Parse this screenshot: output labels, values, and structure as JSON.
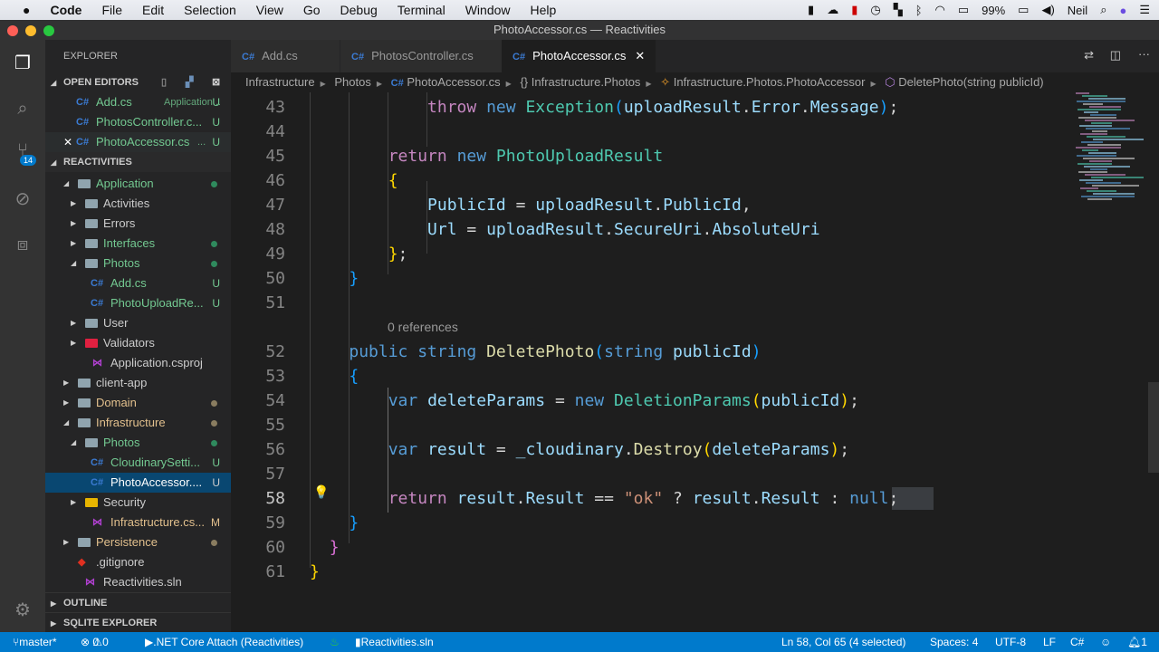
{
  "menubar": {
    "apple": "",
    "app": "Code",
    "items": [
      "File",
      "Edit",
      "Selection",
      "View",
      "Go",
      "Debug",
      "Terminal",
      "Window",
      "Help"
    ],
    "battery": "99%",
    "user": "Neil"
  },
  "window": {
    "title": "PhotoAccessor.cs — Reactivities"
  },
  "sidebar": {
    "title": "EXPLORER",
    "open_editors_label": "OPEN EDITORS",
    "open_editors": [
      {
        "name": "Add.cs",
        "desc": "Application...",
        "status": "U"
      },
      {
        "name": "PhotosController.c...",
        "status": "U"
      },
      {
        "name": "PhotoAccessor.cs",
        "desc": "...",
        "status": "U"
      }
    ],
    "project_label": "REACTIVITIES",
    "tree": [
      {
        "name": "Application",
        "depth": 0,
        "type": "folder",
        "open": true,
        "color": "g",
        "dot": "#2f8a5d"
      },
      {
        "name": "Activities",
        "depth": 1,
        "type": "folder",
        "open": false,
        "color": "w"
      },
      {
        "name": "Errors",
        "depth": 1,
        "type": "folder",
        "open": false,
        "color": "w"
      },
      {
        "name": "Interfaces",
        "depth": 1,
        "type": "folder",
        "open": false,
        "color": "g",
        "dot": "#2f8a5d"
      },
      {
        "name": "Photos",
        "depth": 1,
        "type": "folder",
        "open": true,
        "color": "g",
        "dot": "#2f8a5d"
      },
      {
        "name": "Add.cs",
        "depth": 2,
        "type": "cs",
        "color": "g",
        "status": "U"
      },
      {
        "name": "PhotoUploadRe...",
        "depth": 2,
        "type": "cs",
        "color": "g",
        "status": "U"
      },
      {
        "name": "User",
        "depth": 1,
        "type": "folder",
        "open": false,
        "color": "w"
      },
      {
        "name": "Validators",
        "depth": 1,
        "type": "redfolder",
        "open": false,
        "color": "w"
      },
      {
        "name": "Application.csproj",
        "depth": 1,
        "type": "vs",
        "color": "w"
      },
      {
        "name": "client-app",
        "depth": 0,
        "type": "folder",
        "open": false,
        "color": "w"
      },
      {
        "name": "Domain",
        "depth": 0,
        "type": "folder",
        "open": false,
        "color": "y",
        "dot": "#8a7d60"
      },
      {
        "name": "Infrastructure",
        "depth": 0,
        "type": "folder",
        "open": true,
        "color": "y",
        "dot": "#8a7d60"
      },
      {
        "name": "Photos",
        "depth": 1,
        "type": "folder",
        "open": true,
        "color": "g",
        "dot": "#2f8a5d"
      },
      {
        "name": "CloudinarySetti...",
        "depth": 2,
        "type": "cs",
        "color": "g",
        "status": "U"
      },
      {
        "name": "PhotoAccessor....",
        "depth": 2,
        "type": "cs",
        "color": "w",
        "status": "U",
        "selected": true
      },
      {
        "name": "Security",
        "depth": 1,
        "type": "yfolder",
        "open": false,
        "color": "w"
      },
      {
        "name": "Infrastructure.cs...",
        "depth": 1,
        "type": "vs",
        "color": "y",
        "status": "M"
      },
      {
        "name": "Persistence",
        "depth": 0,
        "type": "folder",
        "open": false,
        "color": "y",
        "dot": "#8a7d60"
      },
      {
        "name": ".gitignore",
        "depth": 0,
        "type": "git",
        "color": "w"
      },
      {
        "name": "Reactivities.sln",
        "depth": 0,
        "type": "vs",
        "color": "w"
      }
    ],
    "outline_label": "OUTLINE",
    "sqlite_label": "SQLITE EXPLORER"
  },
  "activity": {
    "scm_badge": "14"
  },
  "tabs": [
    {
      "label": "Add.cs",
      "icon": "C#"
    },
    {
      "label": "PhotosController.cs",
      "icon": "C#"
    },
    {
      "label": "PhotoAccessor.cs",
      "icon": "C#",
      "active": true
    }
  ],
  "breadcrumb": [
    "Infrastructure",
    "Photos",
    "PhotoAccessor.cs",
    "Infrastructure.Photos",
    "Infrastructure.Photos.PhotoAccessor",
    "DeletePhoto(string publicId)"
  ],
  "editor": {
    "codelens": "0 references",
    "lines": [
      {
        "n": 43,
        "t": [
          [
            "            ",
            "pl"
          ],
          [
            "throw ",
            "kw"
          ],
          [
            "new ",
            "kb"
          ],
          [
            "Exception",
            "ty"
          ],
          [
            "(",
            "br3"
          ],
          [
            "uploadResult",
            "va"
          ],
          [
            ".",
            "pl"
          ],
          [
            "Error",
            "va"
          ],
          [
            ".",
            "pl"
          ],
          [
            "Message",
            "va"
          ],
          [
            ")",
            "br3"
          ],
          [
            ";",
            "pl"
          ]
        ]
      },
      {
        "n": 44,
        "t": []
      },
      {
        "n": 45,
        "t": [
          [
            "        ",
            "pl"
          ],
          [
            "return ",
            "kw"
          ],
          [
            "new ",
            "kb"
          ],
          [
            "PhotoUploadResult",
            "ty"
          ]
        ]
      },
      {
        "n": 46,
        "t": [
          [
            "        ",
            "pl"
          ],
          [
            "{",
            "br1"
          ]
        ]
      },
      {
        "n": 47,
        "t": [
          [
            "            ",
            "pl"
          ],
          [
            "PublicId",
            "va"
          ],
          [
            " = ",
            "pl"
          ],
          [
            "uploadResult",
            "va"
          ],
          [
            ".",
            "pl"
          ],
          [
            "PublicId",
            "va"
          ],
          [
            ",",
            "pl"
          ]
        ]
      },
      {
        "n": 48,
        "t": [
          [
            "            ",
            "pl"
          ],
          [
            "Url",
            "va"
          ],
          [
            " = ",
            "pl"
          ],
          [
            "uploadResult",
            "va"
          ],
          [
            ".",
            "pl"
          ],
          [
            "SecureUri",
            "va"
          ],
          [
            ".",
            "pl"
          ],
          [
            "AbsoluteUri",
            "va"
          ]
        ]
      },
      {
        "n": 49,
        "t": [
          [
            "        ",
            "pl"
          ],
          [
            "}",
            "br1"
          ],
          [
            ";",
            "pl"
          ]
        ]
      },
      {
        "n": 50,
        "t": [
          [
            "    ",
            "pl"
          ],
          [
            "}",
            "br3"
          ]
        ]
      },
      {
        "n": 51,
        "t": []
      },
      {
        "n": 52,
        "t": [
          [
            "    ",
            "pl"
          ],
          [
            "public ",
            "kb"
          ],
          [
            "string ",
            "kb"
          ],
          [
            "DeletePhoto",
            "fn"
          ],
          [
            "(",
            "br3"
          ],
          [
            "string ",
            "kb"
          ],
          [
            "publicId",
            "va"
          ],
          [
            ")",
            "br3"
          ]
        ]
      },
      {
        "n": 53,
        "t": [
          [
            "    ",
            "pl"
          ],
          [
            "{",
            "br3"
          ]
        ]
      },
      {
        "n": 54,
        "t": [
          [
            "        ",
            "pl"
          ],
          [
            "var ",
            "kb"
          ],
          [
            "deleteParams",
            "va"
          ],
          [
            " = ",
            "pl"
          ],
          [
            "new ",
            "kb"
          ],
          [
            "DeletionParams",
            "ty"
          ],
          [
            "(",
            "br1"
          ],
          [
            "publicId",
            "va"
          ],
          [
            ")",
            "br1"
          ],
          [
            ";",
            "pl"
          ]
        ]
      },
      {
        "n": 55,
        "t": []
      },
      {
        "n": 56,
        "t": [
          [
            "        ",
            "pl"
          ],
          [
            "var ",
            "kb"
          ],
          [
            "result",
            "va"
          ],
          [
            " = ",
            "pl"
          ],
          [
            "_cloudinary",
            "va"
          ],
          [
            ".",
            "pl"
          ],
          [
            "Destroy",
            "fn"
          ],
          [
            "(",
            "br1"
          ],
          [
            "deleteParams",
            "va"
          ],
          [
            ")",
            "br1"
          ],
          [
            ";",
            "pl"
          ]
        ]
      },
      {
        "n": 57,
        "t": []
      },
      {
        "n": 58,
        "t": [
          [
            "        ",
            "pl"
          ],
          [
            "return ",
            "kw"
          ],
          [
            "result",
            "va"
          ],
          [
            ".",
            "pl"
          ],
          [
            "Result",
            "va"
          ],
          [
            " == ",
            "pl"
          ],
          [
            "\"ok\"",
            "st"
          ],
          [
            " ? ",
            "pl"
          ],
          [
            "result",
            "va"
          ],
          [
            ".",
            "pl"
          ],
          [
            "Result",
            "va"
          ],
          [
            " : ",
            "pl"
          ],
          [
            "null",
            "kb"
          ],
          [
            ";",
            "pl"
          ]
        ],
        "current": true
      },
      {
        "n": 59,
        "t": [
          [
            "    ",
            "pl"
          ],
          [
            "}",
            "br3"
          ]
        ]
      },
      {
        "n": 60,
        "t": [
          [
            "  ",
            "pl"
          ],
          [
            "}",
            "br2"
          ]
        ]
      },
      {
        "n": 61,
        "t": [
          [
            "}",
            "br1"
          ]
        ]
      }
    ]
  },
  "statusbar": {
    "branch": "master*",
    "errors": "0",
    "warnings": "0",
    "debug": ".NET Core Attach (Reactivities)",
    "solution": "Reactivities.sln",
    "position": "Ln 58, Col 65 (4 selected)",
    "spaces": "Spaces: 4",
    "encoding": "UTF-8",
    "eol": "LF",
    "language": "C#",
    "notifications": "1"
  }
}
